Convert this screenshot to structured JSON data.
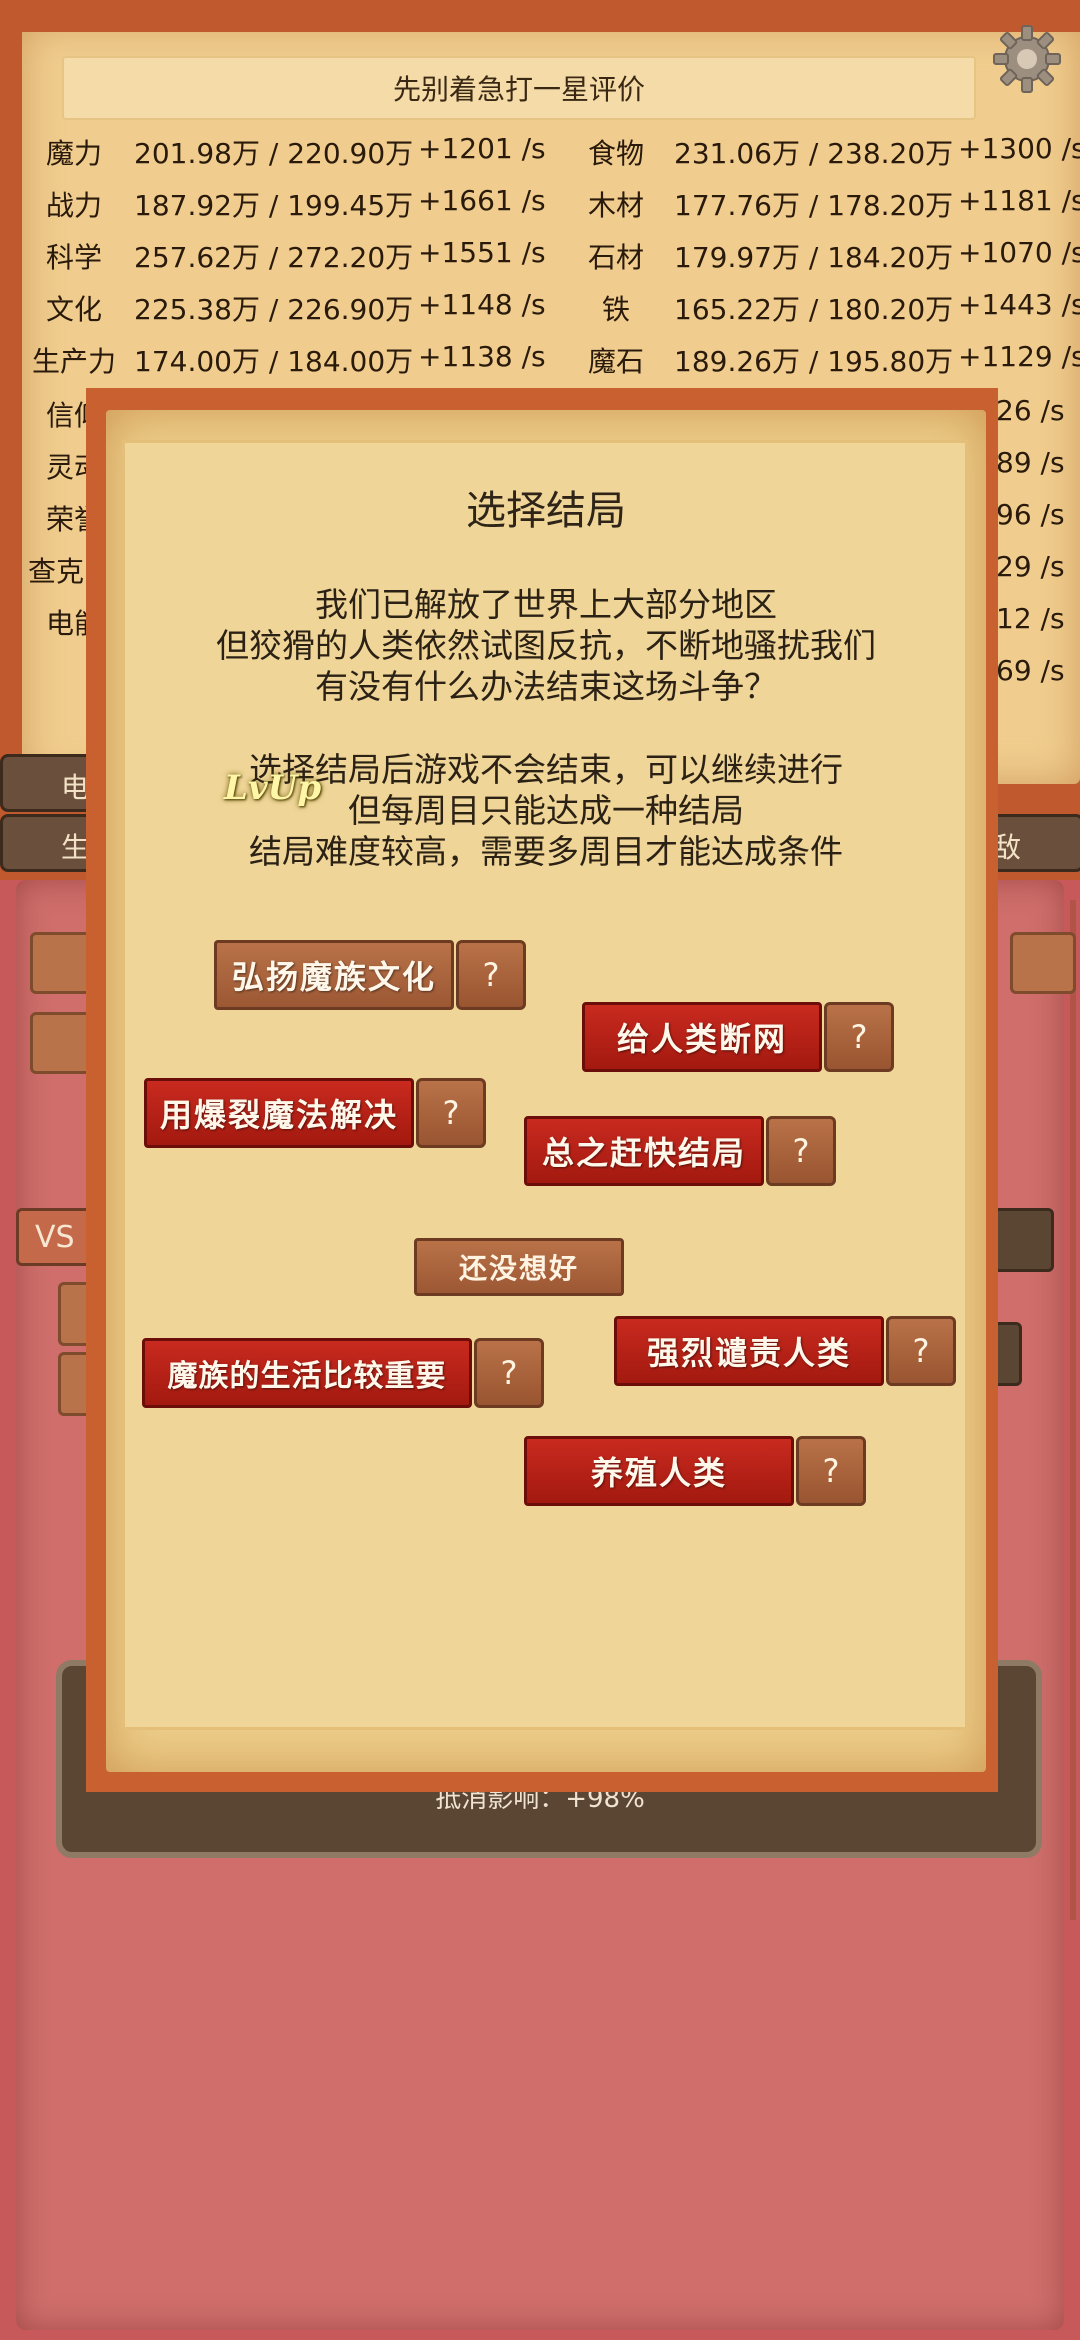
{
  "header": {
    "rating_text": "先别着急打一星评价",
    "settings_icon": "gear-icon"
  },
  "resources": [
    {
      "left_name": "魔力",
      "left_value": "201.98万 / 220.90万",
      "left_rate": "+1201 /s",
      "right_name": "食物",
      "right_value": "231.06万 / 238.20万",
      "right_rate": "+1300 /s"
    },
    {
      "left_name": "战力",
      "left_value": "187.92万 / 199.45万",
      "left_rate": "+1661 /s",
      "right_name": "木材",
      "right_value": "177.76万 / 178.20万",
      "right_rate": "+1181 /s"
    },
    {
      "left_name": "科学",
      "left_value": "257.62万 / 272.20万",
      "left_rate": "+1551 /s",
      "right_name": "石材",
      "right_value": "179.97万 / 184.20万",
      "right_rate": "+1070 /s"
    },
    {
      "left_name": "文化",
      "left_value": "225.38万 / 226.90万",
      "left_rate": "+1148 /s",
      "right_name": "铁",
      "right_value": "165.22万 / 180.20万",
      "right_rate": "+1443 /s"
    },
    {
      "left_name": "生产力",
      "left_value": "174.00万 / 184.00万",
      "left_rate": "+1138 /s",
      "right_name": "魔石",
      "right_value": "189.26万 / 195.80万",
      "right_rate": "+1129 /s"
    }
  ],
  "partial_left": [
    "信仰",
    "灵动",
    "荣誉",
    "查克",
    "电能"
  ],
  "partial_right": [
    "26 /s",
    "89 /s",
    "96 /s",
    "29 /s",
    "12 /s",
    "69 /s"
  ],
  "tabs": {
    "left_top": "电",
    "left_bottom": "生",
    "right_bottom": "敌"
  },
  "vs_label": "VS",
  "effect_text": "抵消影响：+98%",
  "dialog": {
    "title": "选择结局",
    "body_lines_1": [
      "我们已解放了世界上大部分地区",
      "但狡猾的人类依然试图反抗，不断地骚扰我们",
      "有没有什么办法结束这场斗争？"
    ],
    "body_lines_2": [
      "选择结局后游戏不会结束，可以继续进行",
      "但每周目只能达成一种结局",
      "结局难度较高，需要多周目才能达成条件"
    ],
    "lvup_text": "LvUp",
    "question_mark": "?",
    "endings": {
      "culture": "弘扬魔族文化",
      "cut_network": "给人类断网",
      "explosion": "用爆裂魔法解决",
      "finish_fast": "总之赶快结局",
      "life_first": "魔族的生活比较重要",
      "condemn": "强烈谴责人类",
      "farm": "养殖人类"
    },
    "not_decided": "还没想好"
  },
  "colors": {
    "frame": "#c05a2e",
    "parchment": "#efd597",
    "red_button": "#b8231a",
    "brown_button": "#a9623c"
  }
}
